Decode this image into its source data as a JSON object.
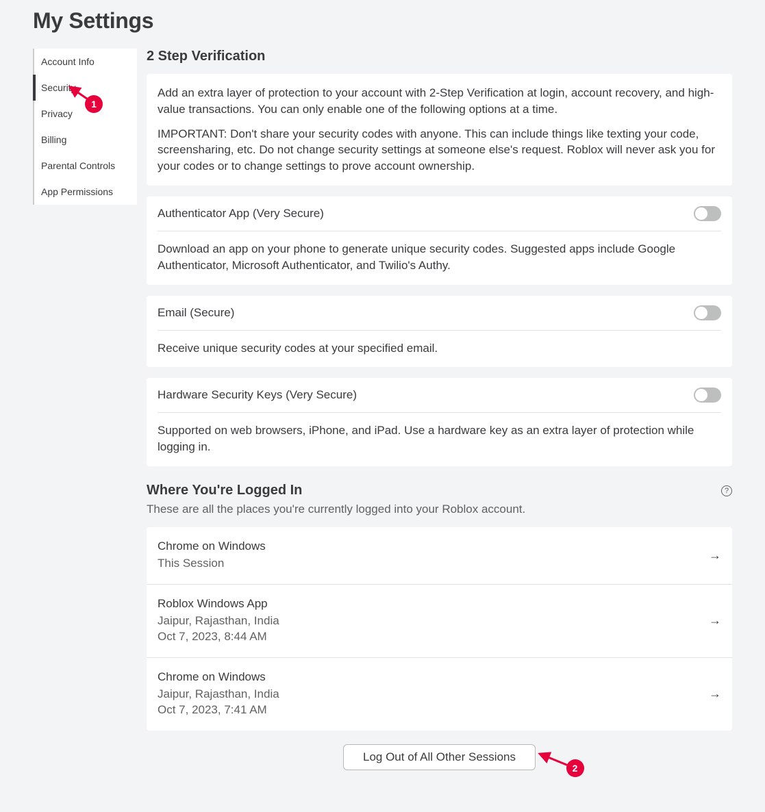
{
  "page_title": "My Settings",
  "sidebar": {
    "items": [
      {
        "label": "Account Info",
        "active": false
      },
      {
        "label": "Security",
        "active": true
      },
      {
        "label": "Privacy",
        "active": false
      },
      {
        "label": "Billing",
        "active": false
      },
      {
        "label": "Parental Controls",
        "active": false
      },
      {
        "label": "App Permissions",
        "active": false
      }
    ]
  },
  "two_step": {
    "heading": "2 Step Verification",
    "intro1": "Add an extra layer of protection to your account with 2-Step Verification at login, account recovery, and high-value transactions. You can only enable one of the following options at a time.",
    "intro2": "IMPORTANT: Don't share your security codes with anyone. This can include things like texting your code, screensharing, etc. Do not change security settings at someone else's request. Roblox will never ask you for your codes or to change settings to prove account ownership.",
    "options": [
      {
        "title": "Authenticator App (Very Secure)",
        "desc": "Download an app on your phone to generate unique security codes. Suggested apps include Google Authenticator, Microsoft Authenticator, and Twilio's Authy.",
        "on": false
      },
      {
        "title": "Email (Secure)",
        "desc": "Receive unique security codes at your specified email.",
        "on": false
      },
      {
        "title": "Hardware Security Keys (Very Secure)",
        "desc": "Supported on web browsers, iPhone, and iPad. Use a hardware key as an extra layer of protection while logging in.",
        "on": false
      }
    ]
  },
  "logged_in": {
    "heading": "Where You're Logged In",
    "subheading": "These are all the places you're currently logged into your Roblox account.",
    "sessions": [
      {
        "name": "Chrome on Windows",
        "detail_line1": "This Session",
        "detail_line2": ""
      },
      {
        "name": "Roblox Windows App",
        "detail_line1": "Jaipur, Rajasthan, India",
        "detail_line2": "Oct 7, 2023, 8:44 AM"
      },
      {
        "name": "Chrome on Windows",
        "detail_line1": "Jaipur, Rajasthan, India",
        "detail_line2": "Oct 7, 2023, 7:41 AM"
      }
    ],
    "logout_button": "Log Out of All Other Sessions"
  },
  "annotations": {
    "a1": "1",
    "a2": "2"
  }
}
